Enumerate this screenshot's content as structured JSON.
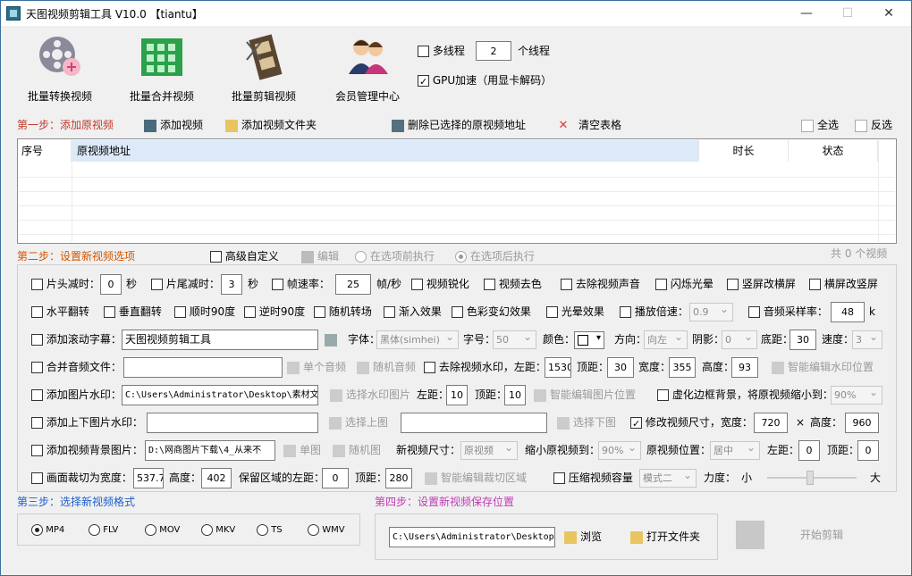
{
  "window": {
    "title": "天图视频剪辑工具 V10.0  【tiantu】",
    "minimize": "—",
    "maximize": "☐",
    "close": "✕"
  },
  "toolbar": {
    "batch_convert": "批量转换视频",
    "batch_merge": "批量合并视频",
    "batch_edit": "批量剪辑视频",
    "member": "会员管理中心",
    "multithread": "多线程",
    "threads_value": "2",
    "threads_unit": "个线程",
    "gpu": "GPU加速（用显卡解码）"
  },
  "step1": {
    "title": "第一步：添加原视频",
    "add_video": "添加视频",
    "add_folder": "添加视频文件夹",
    "delete_selected": "删除已选择的原视频地址",
    "clear_table": "清空表格",
    "select_all": "全选",
    "invert": "反选",
    "columns": [
      "序号",
      "原视频地址",
      "时长",
      "状态"
    ]
  },
  "step2": {
    "title": "第二步：设置新视频选项",
    "advanced": "高级自定义",
    "edit": "编辑",
    "before": "在选项前执行",
    "after": "在选项后执行",
    "count": "共 0 个视频",
    "r1": {
      "head_cut": "片头减时：",
      "head_val": "0",
      "sec1": "秒",
      "tail_cut": "片尾减时：",
      "tail_val": "3",
      "sec2": "秒",
      "fps": "帧速率：",
      "fps_val": "25",
      "fps_unit": "帧/秒",
      "sharpen": "视频锐化",
      "decolor": "视频去色",
      "remove_audio": "去除视频声音",
      "flash": "闪烁光晕",
      "v2h": "竖屏改横屏",
      "h2v": "横屏改竖屏"
    },
    "r2": {
      "hflip": "水平翻转",
      "vflip": "垂直翻转",
      "rot90": "顺时90度",
      "rotm90": "逆时90度",
      "random_trans": "随机转场",
      "fadein": "渐入效果",
      "color": "色彩变幻效果",
      "light": "光晕效果",
      "speed": "播放倍速：",
      "speed_val": "0.9",
      "sample": "音频采样率：",
      "sample_val": "48",
      "sample_unit": "k"
    },
    "r3": {
      "scroll": "添加滚动字幕：",
      "scroll_text": "天图视频剪辑工具",
      "font": "字体：",
      "font_val": "黑体(simhei)",
      "size": "字号：",
      "size_val": "50",
      "color": "颜色：",
      "dir": "方向：",
      "dir_val": "向左",
      "shadow": "阴影：",
      "shadow_val": "0",
      "bottom": "底距：",
      "bottom_val": "30",
      "speed": "速度：",
      "speed_val": "3"
    },
    "r4": {
      "merge_audio": "合并音频文件：",
      "single_audio": "单个音频",
      "random_audio": "随机音频",
      "remove_wm": "去除视频水印，左距：",
      "left_val": "1530",
      "top": "顶距：",
      "top_val": "30",
      "width": "宽度：",
      "width_val": "355",
      "height": "高度：",
      "height_val": "93",
      "smart_wm": "智能编辑水印位置"
    },
    "r5": {
      "img_wm": "添加图片水印：",
      "img_path": "C:\\Users\\Administrator\\Desktop\\素材文件",
      "choose_wm": "选择水印图片",
      "left": "左距：",
      "left_val": "10",
      "top": "顶距：",
      "top_val": "10",
      "smart_img": "智能编辑图片位置",
      "blur_bg": "虚化边框背景，将原视频缩小到：",
      "blur_val": "90%"
    },
    "r6": {
      "tb_wm": "添加上下图片水印：",
      "choose_top": "选择上图",
      "choose_bottom": "选择下图",
      "resize": "修改视频尺寸，宽度：",
      "w_val": "720",
      "x": "×",
      "h": "高度：",
      "h_val": "960"
    },
    "r7": {
      "bg_img": "添加视频背景图片：",
      "bg_path": "D:\\网商图片下载\\4_从来不",
      "single": "单图",
      "random": "随机图",
      "new_size": "新视频尺寸：",
      "new_size_val": "原视频",
      "shrink": "缩小原视频到：",
      "shrink_val": "90%",
      "pos": "原视频位置：",
      "pos_val": "居中",
      "left": "左距：",
      "left_val": "0",
      "top": "顶距：",
      "top_val": "0"
    },
    "r8": {
      "crop": "画面裁切为宽度：",
      "crop_w": "537.7",
      "h": "高度：",
      "h_val": "402",
      "keep_left": "保留区域的左距：",
      "keep_left_val": "0",
      "top": "顶距：",
      "top_val": "280",
      "smart_crop": "智能编辑裁切区域",
      "compress": "压缩视频容量",
      "mode_val": "模式二",
      "strength": "力度：",
      "small": "小",
      "big": "大"
    }
  },
  "step3": {
    "title": "第三步：选择新视频格式",
    "formats": [
      "MP4",
      "FLV",
      "MOV",
      "MKV",
      "TS",
      "WMV"
    ]
  },
  "step4": {
    "title": "第四步：设置新视频保存位置",
    "path": "C:\\Users\\Administrator\\Desktop\\",
    "browse": "浏览",
    "open_folder": "打开文件夹",
    "start": "开始剪辑"
  }
}
